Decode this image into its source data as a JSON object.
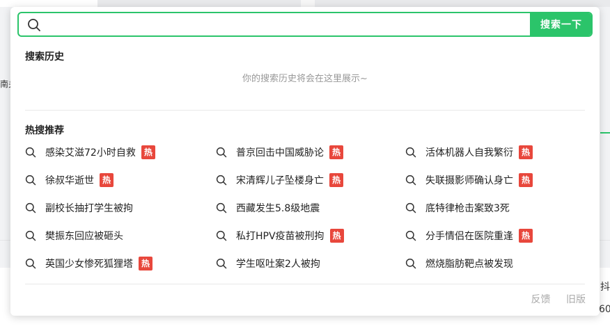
{
  "search": {
    "placeholder": "",
    "button_label": "搜索一下"
  },
  "history": {
    "title": "搜索历史",
    "empty_hint": "你的搜索历史将会在这里展示~"
  },
  "hot": {
    "title": "热搜推荐",
    "badge_label": "热",
    "badge_color": "#e8473c",
    "items": [
      {
        "text": "感染艾滋72小时自救",
        "hot": true
      },
      {
        "text": "普京回击中国威胁论",
        "hot": true
      },
      {
        "text": "活体机器人自我繁衍",
        "hot": true
      },
      {
        "text": "徐叔华逝世",
        "hot": true
      },
      {
        "text": "宋清辉儿子坠楼身亡",
        "hot": true
      },
      {
        "text": "失联摄影师确认身亡",
        "hot": true
      },
      {
        "text": "副校长抽打学生被拘",
        "hot": false
      },
      {
        "text": "西藏发生5.8级地震",
        "hot": false
      },
      {
        "text": "底特律枪击案致3死",
        "hot": false
      },
      {
        "text": "樊振东回应被砸头",
        "hot": false
      },
      {
        "text": "私打HPV疫苗被刑拘",
        "hot": true
      },
      {
        "text": "分手情侣在医院重逢",
        "hot": true
      },
      {
        "text": "英国少女惨死狐狸塔",
        "hot": true
      },
      {
        "text": "学生呕吐案2人被拘",
        "hot": false
      },
      {
        "text": "燃烧脂肪靶点被发现",
        "hot": false
      }
    ]
  },
  "footer": {
    "feedback": "反馈",
    "old_version": "旧版"
  },
  "accent_color": "#2bc46a",
  "background_page": {
    "right_edge": [
      "抖",
      "60"
    ],
    "left_edge": [
      "南关"
    ]
  }
}
